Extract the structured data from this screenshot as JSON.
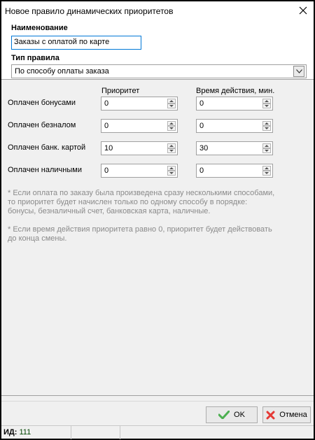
{
  "window": {
    "title": "Новое правило динамических приоритетов"
  },
  "name_section": {
    "label": "Наименование",
    "value": "Заказы с оплатой по карте"
  },
  "rule_type": {
    "label": "Тип правила",
    "selected": "По способу оплаты заказа"
  },
  "columns": {
    "priority": "Приоритет",
    "duration": "Время действия, мин."
  },
  "rows": [
    {
      "label": "Оплачен бонусами",
      "priority": "0",
      "duration": "0"
    },
    {
      "label": "Оплачен безналом",
      "priority": "0",
      "duration": "0"
    },
    {
      "label": "Оплачен банк. картой",
      "priority": "10",
      "duration": "30"
    },
    {
      "label": "Оплачен наличными",
      "priority": "0",
      "duration": "0"
    }
  ],
  "notes": {
    "note1": "* Если оплата по заказу была произведена сразу несколькими способами,\nто приоритет будет начислен только по одному способу в порядке:\nбонусы, безналичный счет, банковская карта, наличные.",
    "note2": "* Если время действия приоритета равно 0, приоритет будет действовать\nдо конца смены."
  },
  "buttons": {
    "ok": "OK",
    "cancel": "Отмена"
  },
  "status": {
    "id_label": "ИД:",
    "id_value": "111"
  },
  "colors": {
    "accent": "#0078d7",
    "ok_icon": "#4caf50",
    "cancel_icon": "#e53935"
  }
}
